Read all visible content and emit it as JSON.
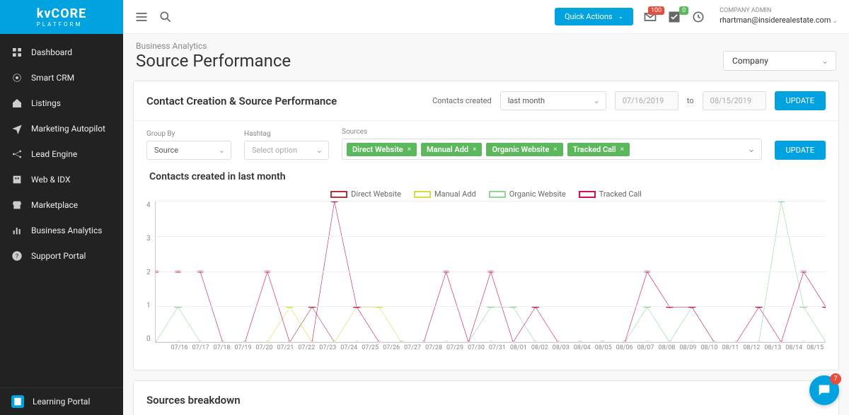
{
  "brand": {
    "name": "kvCORE",
    "sub": "PLATFORM"
  },
  "sidebar": {
    "items": [
      {
        "label": "Dashboard",
        "icon": "grid"
      },
      {
        "label": "Smart CRM",
        "icon": "radar"
      },
      {
        "label": "Listings",
        "icon": "home"
      },
      {
        "label": "Marketing Autopilot",
        "icon": "send"
      },
      {
        "label": "Lead Engine",
        "icon": "nodes"
      },
      {
        "label": "Web & IDX",
        "icon": "building"
      },
      {
        "label": "Marketplace",
        "icon": "store"
      },
      {
        "label": "Business Analytics",
        "icon": "bars"
      },
      {
        "label": "Support Portal",
        "icon": "help"
      }
    ],
    "footer": {
      "label": "Learning Portal",
      "icon": "book"
    }
  },
  "topbar": {
    "quick_actions": "Quick Actions",
    "mail_badge": "100",
    "check_badge": "0",
    "account_role": "Company Admin",
    "account_email": "rhartman@insiderealestate.com"
  },
  "header": {
    "breadcrumb": "Business Analytics",
    "title": "Source Performance",
    "company_select": "Company"
  },
  "card1": {
    "title": "Contact Creation & Source Performance",
    "contacts_label": "Contacts created",
    "range_select": "last month",
    "date_from": "07/16/2019",
    "to": "to",
    "date_to": "08/15/2019",
    "update": "UPDATE"
  },
  "filters": {
    "group_by_label": "Group By",
    "group_by": "Source",
    "hashtag_label": "Hashtag",
    "hashtag": "Select option",
    "sources_label": "Sources",
    "tags": [
      "Direct Website",
      "Manual Add",
      "Organic Website",
      "Tracked Call"
    ],
    "update": "UPDATE"
  },
  "chart": {
    "title": "Contacts created in last month",
    "legend": [
      {
        "name": "Direct Website",
        "color": "#b0333d"
      },
      {
        "name": "Manual Add",
        "color": "#d8df3a"
      },
      {
        "name": "Organic Website",
        "color": "#8fd89a"
      },
      {
        "name": "Tracked Call",
        "color": "#c9125a"
      }
    ]
  },
  "breakdown": {
    "title": "Sources breakdown"
  },
  "chat": {
    "count": "7"
  },
  "chart_data": {
    "type": "line",
    "title": "Contacts created in last month",
    "xlabel": "",
    "ylabel": "",
    "ylim": [
      0,
      4
    ],
    "y_ticks": [
      0,
      1,
      2,
      3,
      4
    ],
    "categories": [
      "07/16",
      "07/17",
      "07/18",
      "07/19",
      "07/20",
      "07/21",
      "07/22",
      "07/23",
      "07/24",
      "07/25",
      "07/26",
      "07/27",
      "07/28",
      "07/29",
      "07/30",
      "07/31",
      "08/01",
      "08/02",
      "08/03",
      "08/04",
      "08/05",
      "08/06",
      "08/07",
      "08/08",
      "08/09",
      "08/10",
      "08/11",
      "08/12",
      "08/13",
      "08/14",
      "08/15"
    ],
    "series": [
      {
        "name": "Direct Website",
        "color": "#b0333d",
        "values": [
          0,
          0,
          0,
          0,
          0,
          0,
          0,
          1,
          0,
          0,
          0,
          0,
          0,
          0,
          0,
          0,
          0,
          0,
          0,
          0,
          0,
          0,
          0,
          0,
          0,
          0,
          0,
          0,
          0,
          0,
          0
        ]
      },
      {
        "name": "Manual Add",
        "color": "#d8df3a",
        "values": [
          0,
          0,
          0,
          0,
          0,
          0,
          1,
          0,
          0,
          1,
          1,
          0,
          0,
          0,
          0,
          0,
          0,
          0,
          0,
          0,
          0,
          0,
          0,
          0,
          0,
          0,
          0,
          0,
          0,
          0,
          0
        ]
      },
      {
        "name": "Organic Website",
        "color": "#8fd89a",
        "values": [
          0,
          1,
          0,
          0,
          0,
          0,
          0,
          0,
          0,
          0,
          0,
          0,
          0,
          0,
          0,
          1,
          1,
          0,
          0,
          0,
          0,
          0,
          1,
          0,
          1,
          0,
          0,
          0,
          4,
          1,
          0
        ]
      },
      {
        "name": "Tracked Call",
        "color": "#c9125a",
        "values": [
          2,
          2,
          2,
          0,
          0,
          2,
          0,
          0,
          4,
          1,
          0,
          0,
          0,
          2,
          0,
          2,
          0,
          1,
          0,
          0,
          0,
          0,
          2,
          1,
          1,
          0,
          0,
          1,
          0,
          2,
          1
        ]
      }
    ]
  }
}
